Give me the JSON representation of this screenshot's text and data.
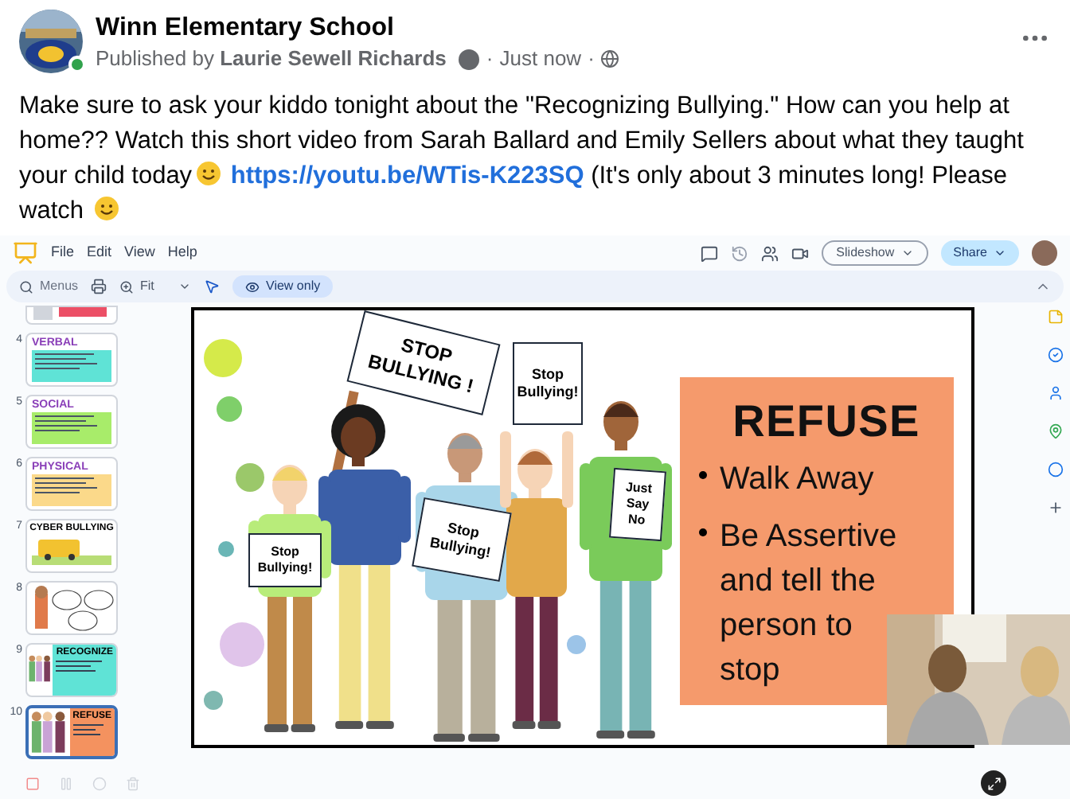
{
  "post": {
    "page_name": "Winn Elementary School",
    "published_prefix": "Published by",
    "author": "Laurie Sewell Richards",
    "separator_1": "·",
    "time": "Just now",
    "separator_2": "·",
    "online": true,
    "message": {
      "before": "Make sure to ask your kiddo tonight about the \"Recognizing Bullying.\" How can you help at home?? Watch this short video from Sarah Ballard and Emily Sellers about what they taught your child today",
      "link": "https://youtu.be/WTis-K223SQ",
      "after": "(It's only about 3 minutes long! Please watch"
    }
  },
  "video": {
    "slides_app": {
      "menu": [
        "File",
        "Edit",
        "View",
        "Help"
      ],
      "search_placeholder": "Menus",
      "zoom": "Fit",
      "mode": "View only",
      "slideshow_button": "Slideshow",
      "share_button": "Share"
    },
    "thumbnails": [
      {
        "kind": "cut",
        "selected": false
      },
      {
        "kind": "text",
        "number": "4",
        "title": "VERBAL",
        "color": "#5fe3d6",
        "selected": false
      },
      {
        "kind": "text",
        "number": "5",
        "title": "SOCIAL",
        "color": "#a8ec6a",
        "selected": false
      },
      {
        "kind": "text",
        "number": "6",
        "title": "PHYSICAL",
        "color": "#fbd98a",
        "selected": false
      },
      {
        "kind": "bus",
        "number": "7",
        "title": "CYBER BULLYING",
        "selected": false
      },
      {
        "kind": "bubbles",
        "number": "8",
        "selected": false
      },
      {
        "kind": "figures",
        "number": "9",
        "title": "RECOGNIZE",
        "color": "#5fe3d6",
        "selected": false
      },
      {
        "kind": "figures",
        "number": "10",
        "title": "REFUSE",
        "color": "#f4925f",
        "selected": true
      }
    ],
    "slide": {
      "signs": [
        "STOP BULLYING !",
        "Stop Bullying!",
        "Stop Bullying!",
        "Stop Bullying!",
        "Just Say No"
      ],
      "heading": "REFUSE",
      "bullets": [
        "Walk Away",
        "Be Assertive and tell the person to stop"
      ]
    }
  }
}
